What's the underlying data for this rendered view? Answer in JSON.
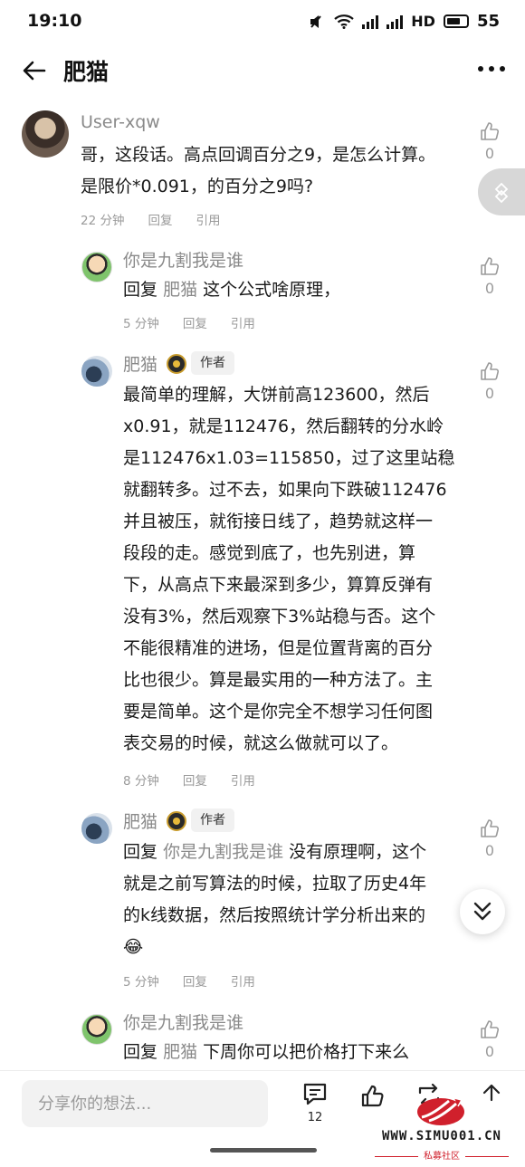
{
  "status_bar": {
    "time": "19:10",
    "network": "4G",
    "hd": "HD",
    "battery": "55"
  },
  "nav": {
    "title": "肥猫"
  },
  "comments": [
    {
      "user": "User-xqw",
      "text": [
        "哥，这段话。高点回调百分之9，是怎么计算。",
        "是限价*0.091，的百分之9吗?"
      ],
      "time": "22 分钟",
      "reply": "回复",
      "quote": "引用",
      "likes": "0"
    },
    {
      "user": "你是九割我是谁",
      "reply_prefix": "回复",
      "reply_to": "肥猫",
      "text": [
        "这个公式啥原理，"
      ],
      "time": "5 分钟",
      "reply": "回复",
      "quote": "引用",
      "likes": "0"
    },
    {
      "user": "肥猫",
      "author_tag": "作者",
      "text": [
        "最简单的理解，大饼前高123600，然后",
        "x0.91，就是112476，然后翻转的分水岭",
        "是112476x1.03=115850，过了这里站稳",
        "就翻转多。过不去，如果向下跌破112476",
        "并且被压，就衔接日线了，趋势就这样一",
        "段段的走。感觉到底了，也先别进，算",
        "下，从高点下来最深到多少，算算反弹有",
        "没有3%，然后观察下3%站稳与否。这个",
        "不能很精准的进场，但是位置背离的百分",
        "比也很少。算是最实用的一种方法了。主",
        "要是简单。这个是你完全不想学习任何图",
        "表交易的时候，就这么做就可以了。"
      ],
      "time": "8 分钟",
      "reply": "回复",
      "quote": "引用",
      "likes": "0"
    },
    {
      "user": "肥猫",
      "author_tag": "作者",
      "reply_prefix": "回复",
      "reply_to": "你是九割我是谁",
      "text": [
        "没有原理啊，这个",
        "就是之前写算法的时候，拉取了历史4年",
        "的k线数据，然后按照统计学分析出来的",
        "😂"
      ],
      "time": "5 分钟",
      "reply": "回复",
      "quote": "引用",
      "likes": "0"
    },
    {
      "user": "你是九割我是谁",
      "reply_prefix": "回复",
      "reply_to": "肥猫",
      "text": [
        "下周你可以把价格打下来么"
      ],
      "likes": "0"
    }
  ],
  "bottom": {
    "placeholder": "分享你的想法...",
    "comment_count": "12"
  },
  "watermark": {
    "domain": "WWW.SIMU001.CN",
    "sub": "私募社区"
  }
}
